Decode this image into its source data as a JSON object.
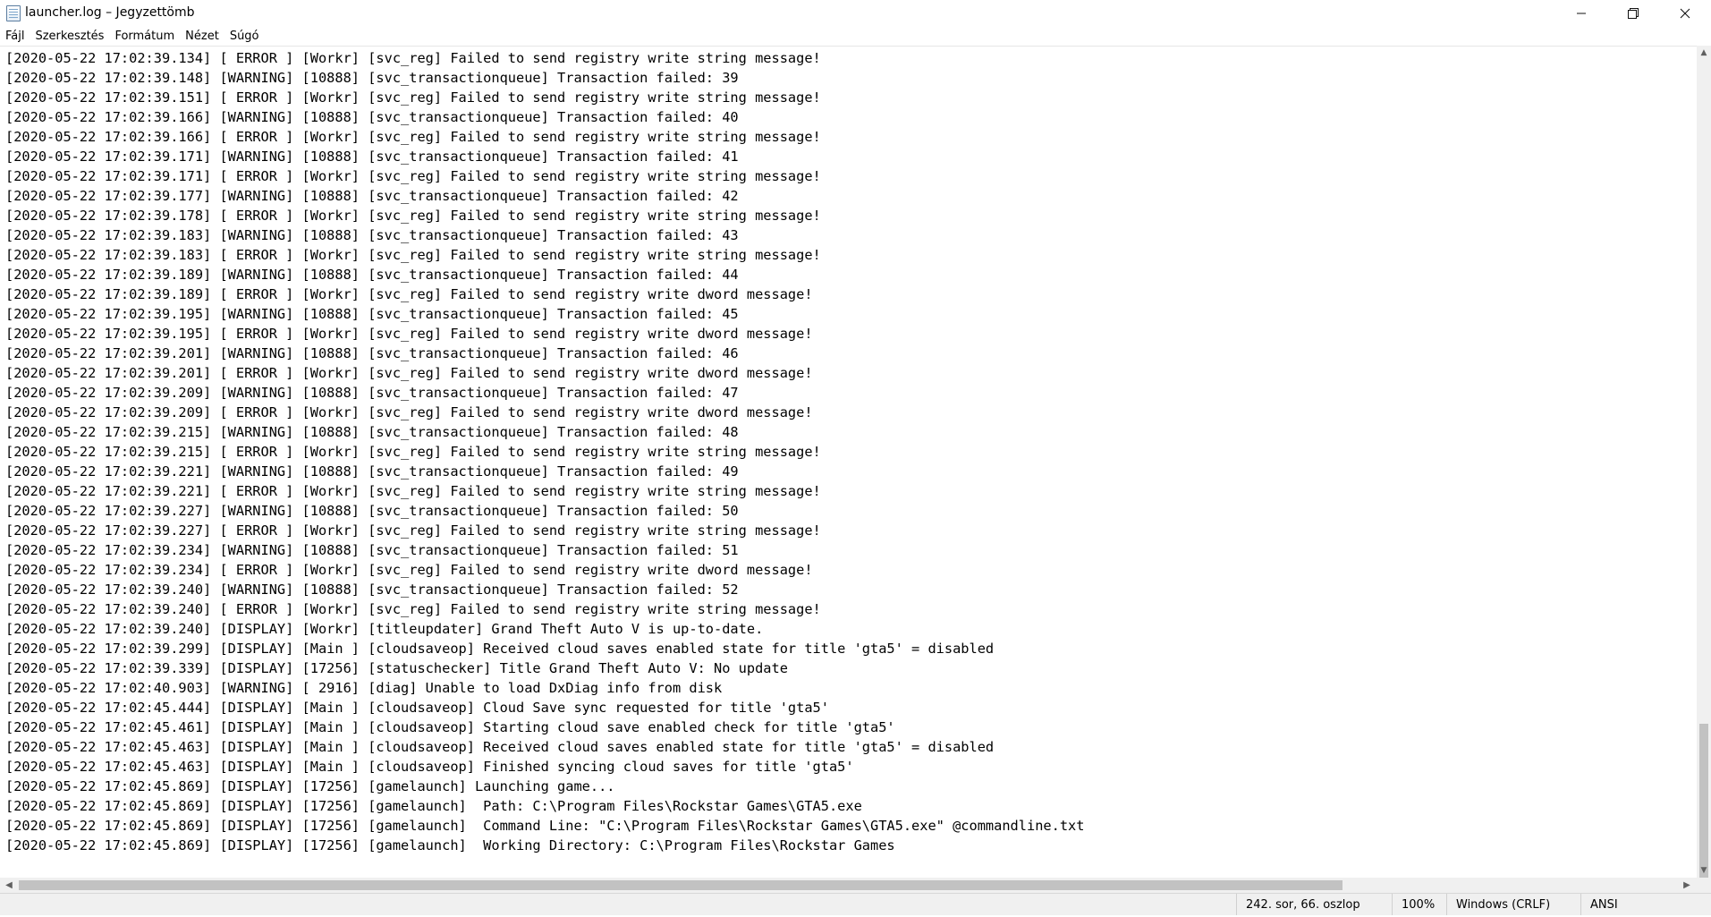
{
  "window": {
    "title": "launcher.log – Jegyzettömb",
    "icon": "notepad-icon"
  },
  "menu": {
    "items": [
      "Fájl",
      "Szerkesztés",
      "Formátum",
      "Nézet",
      "Súgó"
    ]
  },
  "log": {
    "lines": [
      "[2020-05-22 17:02:39.134] [ ERROR ] [Workr] [svc_reg] Failed to send registry write string message!",
      "[2020-05-22 17:02:39.148] [WARNING] [10888] [svc_transactionqueue] Transaction failed: 39",
      "[2020-05-22 17:02:39.151] [ ERROR ] [Workr] [svc_reg] Failed to send registry write string message!",
      "[2020-05-22 17:02:39.166] [WARNING] [10888] [svc_transactionqueue] Transaction failed: 40",
      "[2020-05-22 17:02:39.166] [ ERROR ] [Workr] [svc_reg] Failed to send registry write string message!",
      "[2020-05-22 17:02:39.171] [WARNING] [10888] [svc_transactionqueue] Transaction failed: 41",
      "[2020-05-22 17:02:39.171] [ ERROR ] [Workr] [svc_reg] Failed to send registry write string message!",
      "[2020-05-22 17:02:39.177] [WARNING] [10888] [svc_transactionqueue] Transaction failed: 42",
      "[2020-05-22 17:02:39.178] [ ERROR ] [Workr] [svc_reg] Failed to send registry write string message!",
      "[2020-05-22 17:02:39.183] [WARNING] [10888] [svc_transactionqueue] Transaction failed: 43",
      "[2020-05-22 17:02:39.183] [ ERROR ] [Workr] [svc_reg] Failed to send registry write string message!",
      "[2020-05-22 17:02:39.189] [WARNING] [10888] [svc_transactionqueue] Transaction failed: 44",
      "[2020-05-22 17:02:39.189] [ ERROR ] [Workr] [svc_reg] Failed to send registry write dword message!",
      "[2020-05-22 17:02:39.195] [WARNING] [10888] [svc_transactionqueue] Transaction failed: 45",
      "[2020-05-22 17:02:39.195] [ ERROR ] [Workr] [svc_reg] Failed to send registry write dword message!",
      "[2020-05-22 17:02:39.201] [WARNING] [10888] [svc_transactionqueue] Transaction failed: 46",
      "[2020-05-22 17:02:39.201] [ ERROR ] [Workr] [svc_reg] Failed to send registry write dword message!",
      "[2020-05-22 17:02:39.209] [WARNING] [10888] [svc_transactionqueue] Transaction failed: 47",
      "[2020-05-22 17:02:39.209] [ ERROR ] [Workr] [svc_reg] Failed to send registry write dword message!",
      "[2020-05-22 17:02:39.215] [WARNING] [10888] [svc_transactionqueue] Transaction failed: 48",
      "[2020-05-22 17:02:39.215] [ ERROR ] [Workr] [svc_reg] Failed to send registry write string message!",
      "[2020-05-22 17:02:39.221] [WARNING] [10888] [svc_transactionqueue] Transaction failed: 49",
      "[2020-05-22 17:02:39.221] [ ERROR ] [Workr] [svc_reg] Failed to send registry write string message!",
      "[2020-05-22 17:02:39.227] [WARNING] [10888] [svc_transactionqueue] Transaction failed: 50",
      "[2020-05-22 17:02:39.227] [ ERROR ] [Workr] [svc_reg] Failed to send registry write string message!",
      "[2020-05-22 17:02:39.234] [WARNING] [10888] [svc_transactionqueue] Transaction failed: 51",
      "[2020-05-22 17:02:39.234] [ ERROR ] [Workr] [svc_reg] Failed to send registry write dword message!",
      "[2020-05-22 17:02:39.240] [WARNING] [10888] [svc_transactionqueue] Transaction failed: 52",
      "[2020-05-22 17:02:39.240] [ ERROR ] [Workr] [svc_reg] Failed to send registry write string message!",
      "[2020-05-22 17:02:39.240] [DISPLAY] [Workr] [titleupdater] Grand Theft Auto V is up-to-date.",
      "[2020-05-22 17:02:39.299] [DISPLAY] [Main ] [cloudsaveop] Received cloud saves enabled state for title 'gta5' = disabled",
      "[2020-05-22 17:02:39.339] [DISPLAY] [17256] [statuschecker] Title Grand Theft Auto V: No update",
      "[2020-05-22 17:02:40.903] [WARNING] [ 2916] [diag] Unable to load DxDiag info from disk",
      "[2020-05-22 17:02:45.444] [DISPLAY] [Main ] [cloudsaveop] Cloud Save sync requested for title 'gta5'",
      "[2020-05-22 17:02:45.461] [DISPLAY] [Main ] [cloudsaveop] Starting cloud save enabled check for title 'gta5'",
      "[2020-05-22 17:02:45.463] [DISPLAY] [Main ] [cloudsaveop] Received cloud saves enabled state for title 'gta5' = disabled",
      "[2020-05-22 17:02:45.463] [DISPLAY] [Main ] [cloudsaveop] Finished syncing cloud saves for title 'gta5'",
      "[2020-05-22 17:02:45.869] [DISPLAY] [17256] [gamelaunch] Launching game...",
      "[2020-05-22 17:02:45.869] [DISPLAY] [17256] [gamelaunch]  Path: C:\\Program Files\\Rockstar Games\\GTA5.exe",
      "[2020-05-22 17:02:45.869] [DISPLAY] [17256] [gamelaunch]  Command Line: \"C:\\Program Files\\Rockstar Games\\GTA5.exe\" @commandline.txt",
      "[2020-05-22 17:02:45.869] [DISPLAY] [17256] [gamelaunch]  Working Directory: C:\\Program Files\\Rockstar Games"
    ]
  },
  "status": {
    "position": "242. sor, 66. oszlop",
    "zoom": "100%",
    "line_ending": "Windows (CRLF)",
    "encoding": "ANSI"
  }
}
